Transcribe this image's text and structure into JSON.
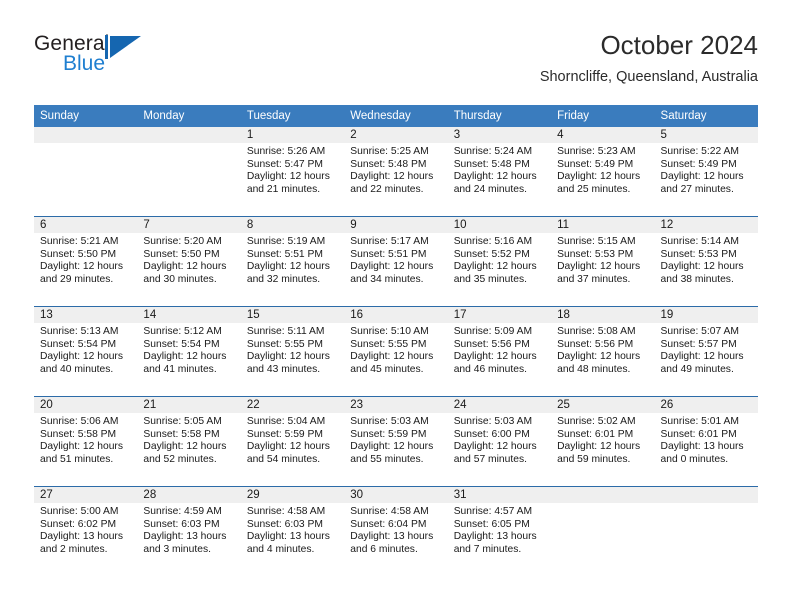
{
  "brand": {
    "name_top": "General",
    "name_bottom": "Blue",
    "logo_icon": "triangle-logo-icon",
    "color_dark": "#231f20",
    "color_blue": "#1f7fd0"
  },
  "header": {
    "title": "October 2024",
    "subtitle": "Shorncliffe, Queensland, Australia"
  },
  "theme": {
    "header_row_bg": "#3a7cbe",
    "row_divider": "#2c6ba8",
    "daynum_band_bg": "#efefef",
    "text": "#1a1a1a"
  },
  "weekday_headers": [
    "Sunday",
    "Monday",
    "Tuesday",
    "Wednesday",
    "Thursday",
    "Friday",
    "Saturday"
  ],
  "weeks": [
    [
      {
        "day": "",
        "sunrise": "",
        "sunset": "",
        "daylight_line1": "",
        "daylight_line2": ""
      },
      {
        "day": "",
        "sunrise": "",
        "sunset": "",
        "daylight_line1": "",
        "daylight_line2": ""
      },
      {
        "day": "1",
        "sunrise": "Sunrise: 5:26 AM",
        "sunset": "Sunset: 5:47 PM",
        "daylight_line1": "Daylight: 12 hours",
        "daylight_line2": "and 21 minutes."
      },
      {
        "day": "2",
        "sunrise": "Sunrise: 5:25 AM",
        "sunset": "Sunset: 5:48 PM",
        "daylight_line1": "Daylight: 12 hours",
        "daylight_line2": "and 22 minutes."
      },
      {
        "day": "3",
        "sunrise": "Sunrise: 5:24 AM",
        "sunset": "Sunset: 5:48 PM",
        "daylight_line1": "Daylight: 12 hours",
        "daylight_line2": "and 24 minutes."
      },
      {
        "day": "4",
        "sunrise": "Sunrise: 5:23 AM",
        "sunset": "Sunset: 5:49 PM",
        "daylight_line1": "Daylight: 12 hours",
        "daylight_line2": "and 25 minutes."
      },
      {
        "day": "5",
        "sunrise": "Sunrise: 5:22 AM",
        "sunset": "Sunset: 5:49 PM",
        "daylight_line1": "Daylight: 12 hours",
        "daylight_line2": "and 27 minutes."
      }
    ],
    [
      {
        "day": "6",
        "sunrise": "Sunrise: 5:21 AM",
        "sunset": "Sunset: 5:50 PM",
        "daylight_line1": "Daylight: 12 hours",
        "daylight_line2": "and 29 minutes."
      },
      {
        "day": "7",
        "sunrise": "Sunrise: 5:20 AM",
        "sunset": "Sunset: 5:50 PM",
        "daylight_line1": "Daylight: 12 hours",
        "daylight_line2": "and 30 minutes."
      },
      {
        "day": "8",
        "sunrise": "Sunrise: 5:19 AM",
        "sunset": "Sunset: 5:51 PM",
        "daylight_line1": "Daylight: 12 hours",
        "daylight_line2": "and 32 minutes."
      },
      {
        "day": "9",
        "sunrise": "Sunrise: 5:17 AM",
        "sunset": "Sunset: 5:51 PM",
        "daylight_line1": "Daylight: 12 hours",
        "daylight_line2": "and 34 minutes."
      },
      {
        "day": "10",
        "sunrise": "Sunrise: 5:16 AM",
        "sunset": "Sunset: 5:52 PM",
        "daylight_line1": "Daylight: 12 hours",
        "daylight_line2": "and 35 minutes."
      },
      {
        "day": "11",
        "sunrise": "Sunrise: 5:15 AM",
        "sunset": "Sunset: 5:53 PM",
        "daylight_line1": "Daylight: 12 hours",
        "daylight_line2": "and 37 minutes."
      },
      {
        "day": "12",
        "sunrise": "Sunrise: 5:14 AM",
        "sunset": "Sunset: 5:53 PM",
        "daylight_line1": "Daylight: 12 hours",
        "daylight_line2": "and 38 minutes."
      }
    ],
    [
      {
        "day": "13",
        "sunrise": "Sunrise: 5:13 AM",
        "sunset": "Sunset: 5:54 PM",
        "daylight_line1": "Daylight: 12 hours",
        "daylight_line2": "and 40 minutes."
      },
      {
        "day": "14",
        "sunrise": "Sunrise: 5:12 AM",
        "sunset": "Sunset: 5:54 PM",
        "daylight_line1": "Daylight: 12 hours",
        "daylight_line2": "and 41 minutes."
      },
      {
        "day": "15",
        "sunrise": "Sunrise: 5:11 AM",
        "sunset": "Sunset: 5:55 PM",
        "daylight_line1": "Daylight: 12 hours",
        "daylight_line2": "and 43 minutes."
      },
      {
        "day": "16",
        "sunrise": "Sunrise: 5:10 AM",
        "sunset": "Sunset: 5:55 PM",
        "daylight_line1": "Daylight: 12 hours",
        "daylight_line2": "and 45 minutes."
      },
      {
        "day": "17",
        "sunrise": "Sunrise: 5:09 AM",
        "sunset": "Sunset: 5:56 PM",
        "daylight_line1": "Daylight: 12 hours",
        "daylight_line2": "and 46 minutes."
      },
      {
        "day": "18",
        "sunrise": "Sunrise: 5:08 AM",
        "sunset": "Sunset: 5:56 PM",
        "daylight_line1": "Daylight: 12 hours",
        "daylight_line2": "and 48 minutes."
      },
      {
        "day": "19",
        "sunrise": "Sunrise: 5:07 AM",
        "sunset": "Sunset: 5:57 PM",
        "daylight_line1": "Daylight: 12 hours",
        "daylight_line2": "and 49 minutes."
      }
    ],
    [
      {
        "day": "20",
        "sunrise": "Sunrise: 5:06 AM",
        "sunset": "Sunset: 5:58 PM",
        "daylight_line1": "Daylight: 12 hours",
        "daylight_line2": "and 51 minutes."
      },
      {
        "day": "21",
        "sunrise": "Sunrise: 5:05 AM",
        "sunset": "Sunset: 5:58 PM",
        "daylight_line1": "Daylight: 12 hours",
        "daylight_line2": "and 52 minutes."
      },
      {
        "day": "22",
        "sunrise": "Sunrise: 5:04 AM",
        "sunset": "Sunset: 5:59 PM",
        "daylight_line1": "Daylight: 12 hours",
        "daylight_line2": "and 54 minutes."
      },
      {
        "day": "23",
        "sunrise": "Sunrise: 5:03 AM",
        "sunset": "Sunset: 5:59 PM",
        "daylight_line1": "Daylight: 12 hours",
        "daylight_line2": "and 55 minutes."
      },
      {
        "day": "24",
        "sunrise": "Sunrise: 5:03 AM",
        "sunset": "Sunset: 6:00 PM",
        "daylight_line1": "Daylight: 12 hours",
        "daylight_line2": "and 57 minutes."
      },
      {
        "day": "25",
        "sunrise": "Sunrise: 5:02 AM",
        "sunset": "Sunset: 6:01 PM",
        "daylight_line1": "Daylight: 12 hours",
        "daylight_line2": "and 59 minutes."
      },
      {
        "day": "26",
        "sunrise": "Sunrise: 5:01 AM",
        "sunset": "Sunset: 6:01 PM",
        "daylight_line1": "Daylight: 13 hours",
        "daylight_line2": "and 0 minutes."
      }
    ],
    [
      {
        "day": "27",
        "sunrise": "Sunrise: 5:00 AM",
        "sunset": "Sunset: 6:02 PM",
        "daylight_line1": "Daylight: 13 hours",
        "daylight_line2": "and 2 minutes."
      },
      {
        "day": "28",
        "sunrise": "Sunrise: 4:59 AM",
        "sunset": "Sunset: 6:03 PM",
        "daylight_line1": "Daylight: 13 hours",
        "daylight_line2": "and 3 minutes."
      },
      {
        "day": "29",
        "sunrise": "Sunrise: 4:58 AM",
        "sunset": "Sunset: 6:03 PM",
        "daylight_line1": "Daylight: 13 hours",
        "daylight_line2": "and 4 minutes."
      },
      {
        "day": "30",
        "sunrise": "Sunrise: 4:58 AM",
        "sunset": "Sunset: 6:04 PM",
        "daylight_line1": "Daylight: 13 hours",
        "daylight_line2": "and 6 minutes."
      },
      {
        "day": "31",
        "sunrise": "Sunrise: 4:57 AM",
        "sunset": "Sunset: 6:05 PM",
        "daylight_line1": "Daylight: 13 hours",
        "daylight_line2": "and 7 minutes."
      },
      {
        "day": "",
        "sunrise": "",
        "sunset": "",
        "daylight_line1": "",
        "daylight_line2": ""
      },
      {
        "day": "",
        "sunrise": "",
        "sunset": "",
        "daylight_line1": "",
        "daylight_line2": ""
      }
    ]
  ]
}
